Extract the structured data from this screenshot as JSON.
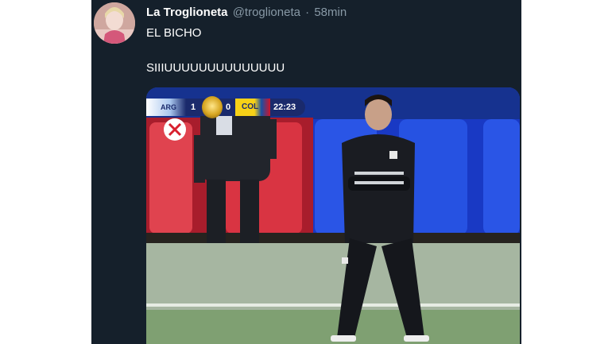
{
  "tweet": {
    "display_name": "La Troglioneta",
    "handle": "@troglioneta",
    "separator": "·",
    "timestamp": "58min",
    "text_line1": "EL BICHO",
    "text_line2": "SIIIUUUUUUUUUUUUUU"
  },
  "scoreboard": {
    "team_left": "ARG",
    "score_left": "1",
    "score_right": "0",
    "team_right": "COL",
    "clock": "22:23"
  },
  "colors": {
    "card_bg": "#15202b",
    "name": "#ffffff",
    "meta": "#8899a6",
    "scoreboard": "#1a2a6c"
  }
}
